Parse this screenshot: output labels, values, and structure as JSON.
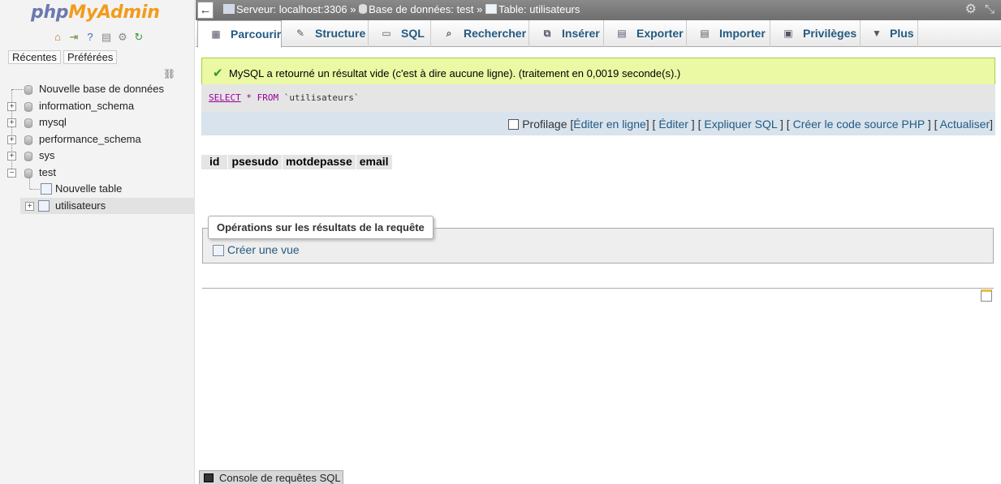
{
  "logo": {
    "part1": "php",
    "part2": "MyAdmin"
  },
  "nav": {
    "recent_label": "Récentes",
    "favorites_label": "Préférées",
    "tree": [
      {
        "label": "Nouvelle base de données"
      },
      {
        "label": "information_schema"
      },
      {
        "label": "mysql"
      },
      {
        "label": "performance_schema"
      },
      {
        "label": "sys"
      },
      {
        "label": "test"
      },
      {
        "label": "Nouvelle table"
      },
      {
        "label": "utilisateurs"
      }
    ]
  },
  "topbar": {
    "server": "Serveur: localhost:3306",
    "sep": "»",
    "database": "Base de données: test",
    "table": "Table: utilisateurs"
  },
  "tabs": [
    {
      "label": "Parcourir"
    },
    {
      "label": "Structure"
    },
    {
      "label": "SQL"
    },
    {
      "label": "Rechercher"
    },
    {
      "label": "Insérer"
    },
    {
      "label": "Exporter"
    },
    {
      "label": "Importer"
    },
    {
      "label": "Privilèges"
    },
    {
      "label": "Plus"
    }
  ],
  "message": "MySQL a retourné un résultat vide (c'est à dire aucune ligne). (traitement en 0,0019 seconde(s).)",
  "sql": {
    "select": "SELECT",
    "star": "*",
    "from": "FROM",
    "table": "`utilisateurs`"
  },
  "sqltools": {
    "profiling": "Profilage",
    "edit_inline": "Éditer en ligne",
    "edit": "Éditer",
    "explain": "Expliquer SQL",
    "php_code": "Créer le code source PHP",
    "refresh": "Actualiser"
  },
  "columns": [
    "id",
    "psesudo",
    "motdepasse",
    "email"
  ],
  "operations": {
    "legend": "Opérations sur les résultats de la requête",
    "create_view": "Créer une vue"
  },
  "console": {
    "label": "Console de requêtes SQL"
  }
}
